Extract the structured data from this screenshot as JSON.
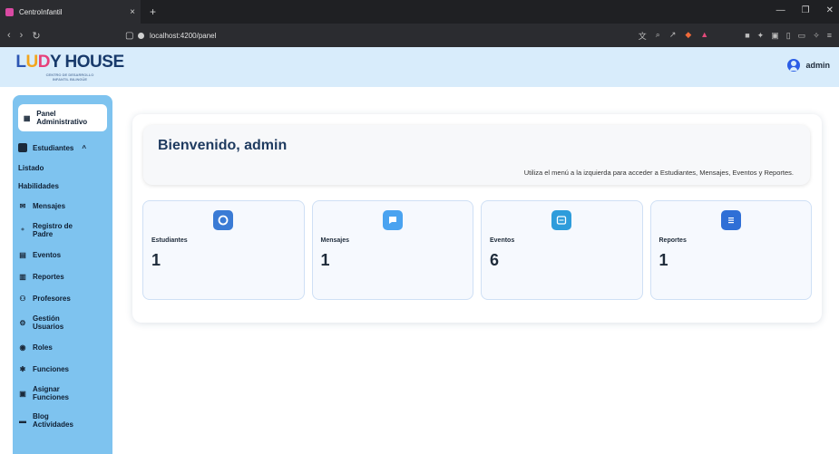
{
  "browser": {
    "tab_title": "CentroInfantil",
    "tab_close": "×",
    "new_tab": "+",
    "url": "localhost:4200/panel"
  },
  "header": {
    "logo_text": "LUDY HOUSE",
    "logo_sub_1": "CENTRO DE DESARROLLO",
    "logo_sub_2": "INFANTIL BILINGÜE",
    "user_name": "admin"
  },
  "sidebar": {
    "panel_label": "Panel Administrativo",
    "estudiantes_label": "Estudiantes",
    "listado_label": "Listado",
    "habilidades_label": "Habilidades",
    "items": [
      {
        "label": "Mensajes",
        "icon": "envelope-icon"
      },
      {
        "label": "Registro de Padre",
        "icon": "add-user-icon"
      },
      {
        "label": "Eventos",
        "icon": "calendar-icon"
      },
      {
        "label": "Reportes",
        "icon": "report-icon"
      },
      {
        "label": "Profesores",
        "icon": "teachers-icon"
      },
      {
        "label": "Gestión Usuarios",
        "icon": "users-gear-icon"
      },
      {
        "label": "Roles",
        "icon": "shield-icon"
      },
      {
        "label": "Funciones",
        "icon": "puzzle-icon"
      },
      {
        "label": "Asignar Funciones",
        "icon": "assign-icon"
      },
      {
        "label": "Blog Actividades",
        "icon": "blog-icon"
      }
    ]
  },
  "main": {
    "welcome_title": "Bienvenido, admin",
    "welcome_text": "Utiliza el menú a la izquierda para acceder a Estudiantes, Mensajes, Eventos y Reportes.",
    "stats": [
      {
        "label": "Estudiantes",
        "value": "1",
        "color": "#3a7bd5",
        "icon": "graduation-cap-icon"
      },
      {
        "label": "Mensajes",
        "value": "1",
        "color": "#4aa3f0",
        "icon": "chat-icon"
      },
      {
        "label": "Eventos",
        "value": "6",
        "color": "#2e9cdb",
        "icon": "calendar-event-icon"
      },
      {
        "label": "Reportes",
        "value": "1",
        "color": "#2f6fd6",
        "icon": "report-icon"
      }
    ]
  }
}
